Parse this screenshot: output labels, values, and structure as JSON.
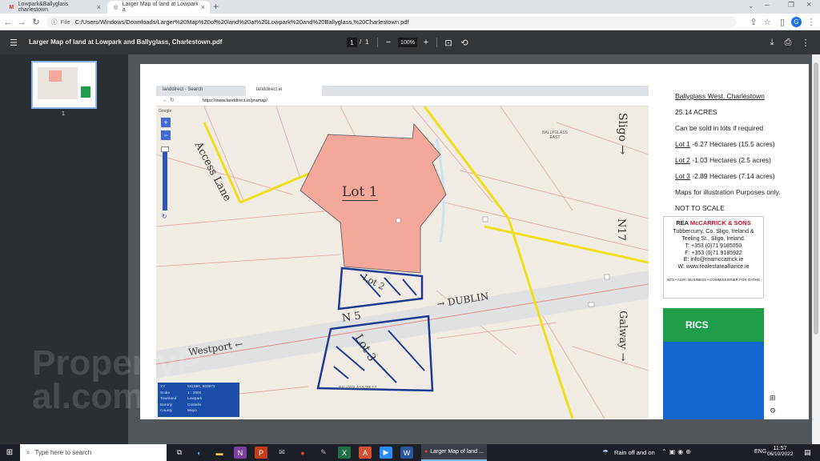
{
  "tabs": [
    {
      "label": "Lowpark&Ballyglass charlestown",
      "active": false
    },
    {
      "label": "Larger Map of land at Lowpark a",
      "active": true
    }
  ],
  "address": {
    "prefix": "File",
    "url": "C:/Users/Windows/Downloads/Larger%20Map%20of%20land%20at%20Lowpark%20and%20Ballyglass,%20Charlestown.pdf"
  },
  "pdf": {
    "title": "Larger Map of land at Lowpark and Ballyglass, Charlestown.pdf",
    "page_current": "1",
    "page_sep": "/",
    "page_total": "1",
    "zoom": "100%"
  },
  "thumb": {
    "page_number": "1"
  },
  "embedded": {
    "tab1": "landdirect - Search",
    "tab2": "landdirect.ie",
    "url": "https://www.landdirect.ie/pramap/",
    "google": "Google",
    "infobox": [
      {
        "k": "XY",
        "v": "541860, 803972"
      },
      {
        "k": "Scale",
        "v": "1 : 2500"
      },
      {
        "k": "Townland",
        "v": "Lowpark"
      },
      {
        "k": "Barony",
        "v": "Costello"
      },
      {
        "k": "County",
        "v": "Mayo"
      }
    ],
    "ballyglass_east": "BALLYGLASS EAST",
    "ballyglass_west": "BALLYGLASS WEST"
  },
  "map_labels": {
    "access_lane": "Access Lane",
    "lot1": "Lot 1",
    "lot2": "Lot 2",
    "lot3": "Lot 3",
    "n5": "N 5",
    "dublin": "→ DUBLIN",
    "westport": "Westport ←",
    "sligo": "Sligo →",
    "n17": "N17",
    "galway": "Galway →"
  },
  "info": {
    "title": "Ballyglass West, Charlestown",
    "acres": "25.14 ACRES",
    "lots_note": "Can be sold in lots if required",
    "lot1": "Lot 1",
    "lot1_val": " -6.27 Hectares (15.5 acres)",
    "lot2": "Lot 2",
    "lot2_val": " -1.03 Hectares (2.5 acres)",
    "lot3": "Lot 3",
    "lot3_val": " -2.89 Hectares (7.14 acres)",
    "maps_note": "Maps for illustration Purposes only.",
    "not_scale": "NOT TO SCALE"
  },
  "agent": {
    "name_a": "REA ",
    "name_b": "McCARRICK & SONS",
    "addr1": "Tubbercurry, Co. Sligo, Ireland &",
    "addr2": "Teeling St., Sligo, Ireland.",
    "tel": "T: +353 (0)71 9185050",
    "fax": "F: +353 (0)71 9185922",
    "email": "E: info@reamccarrick.ie",
    "web": "W: www.realestatealliance.ie",
    "services": "NTS • AGRI. BUSINESS • COMMISSIONER FOR OATHS",
    "rics": "RICS"
  },
  "watermark": "PropertyPal.com",
  "taskbar": {
    "search": "Type here to search",
    "app_label": "Larger Map of land ...",
    "weather": "Rain off and on",
    "lang": "ENG",
    "time": "11:57",
    "date": "06/10/2022"
  },
  "colors": {
    "accent": "#1a73e8",
    "lot1": "#f4a79b",
    "lots_outline": "#1f3a93",
    "road_yellow": "#f2df1b",
    "rics_green": "#1f9d4a",
    "rics_blue": "#1266cc"
  }
}
